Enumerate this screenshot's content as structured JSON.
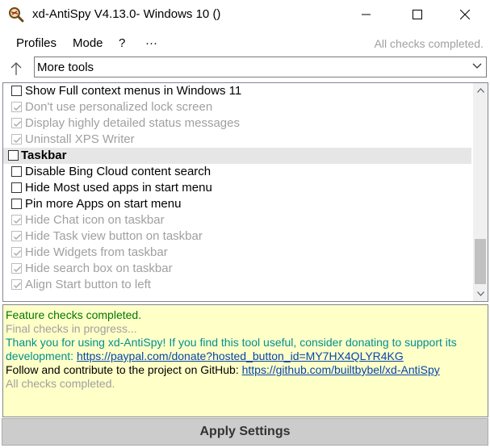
{
  "window": {
    "title": "xd-AntiSpy V4.13.0- Windows 10 ()",
    "icon": "app-logo-icon"
  },
  "menu": {
    "items": [
      "Profiles",
      "Mode",
      "?",
      "···"
    ],
    "status": "All checks completed."
  },
  "toolbar": {
    "up_icon": "up-arrow-icon",
    "selected": "More tools"
  },
  "tree": {
    "rows": [
      {
        "label": "Show Full context menus in Windows 11",
        "checked": false,
        "disabled": false,
        "category": false
      },
      {
        "label": "Don't use personalized lock screen",
        "checked": true,
        "disabled": true,
        "category": false
      },
      {
        "label": "Display highly detailed status messages",
        "checked": true,
        "disabled": true,
        "category": false
      },
      {
        "label": "Uninstall XPS Writer",
        "checked": true,
        "disabled": true,
        "category": false
      },
      {
        "label": "Taskbar",
        "checked": false,
        "disabled": false,
        "category": true
      },
      {
        "label": "Disable Bing Cloud content search",
        "checked": false,
        "disabled": false,
        "category": false
      },
      {
        "label": "Hide Most used apps in start menu",
        "checked": false,
        "disabled": false,
        "category": false
      },
      {
        "label": "Pin more Apps on start menu",
        "checked": false,
        "disabled": false,
        "category": false
      },
      {
        "label": "Hide Chat icon on taskbar",
        "checked": true,
        "disabled": true,
        "category": false
      },
      {
        "label": "Hide Task view button on taskbar",
        "checked": true,
        "disabled": true,
        "category": false
      },
      {
        "label": "Hide Widgets from taskbar",
        "checked": true,
        "disabled": true,
        "category": false
      },
      {
        "label": "Hide search box on taskbar",
        "checked": true,
        "disabled": true,
        "category": false
      },
      {
        "label": "Align Start button to left",
        "checked": true,
        "disabled": true,
        "category": false
      }
    ]
  },
  "log": {
    "line1": "Feature checks completed.",
    "line2": "Final checks in progress...",
    "line3": "Thank you for using xd-AntiSpy! If you find this tool useful, consider donating to support its",
    "line4_prefix": "development: ",
    "line4_link": "https://paypal.com/donate?hosted_button_id=MY7HX4QLYR4KG",
    "line5_prefix": "Follow and contribute to the project on GitHub: ",
    "line5_link": "https://github.com/builtbybel/xd-AntiSpy",
    "line6": "All checks completed."
  },
  "apply_label": "Apply Settings",
  "colors": {
    "log_background": "#ffffc8",
    "success": "#007800",
    "info": "#009090",
    "muted": "#a0a0a0",
    "link": "#0645ad",
    "apply_button": "#cccccc"
  }
}
